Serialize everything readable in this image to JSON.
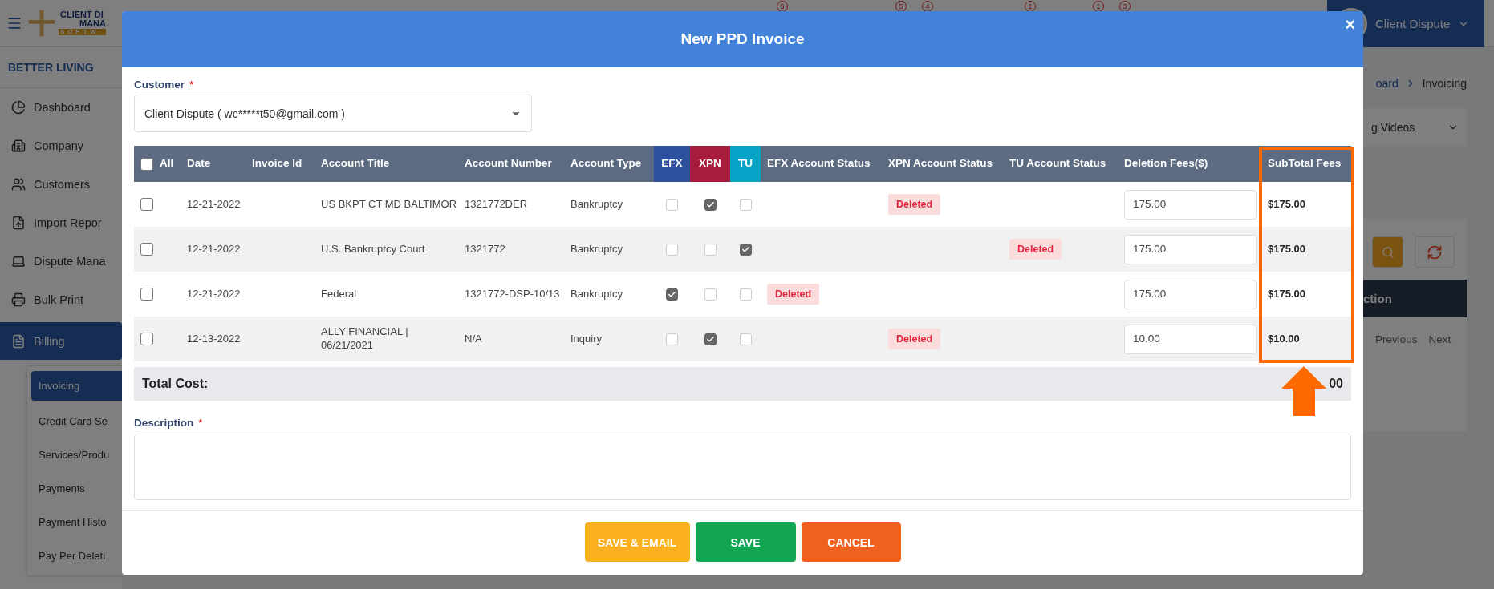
{
  "app": {
    "logo": [
      "CLIENT DI",
      "MANA",
      "SOFTW"
    ],
    "company": "BETTER LIVING",
    "badges": [
      "5",
      "5",
      "4",
      "1",
      "1",
      "3"
    ],
    "user": "Client Dispute"
  },
  "sidebar": {
    "items": [
      {
        "label": "Dashboard",
        "selected": false
      },
      {
        "label": "Company",
        "selected": false
      },
      {
        "label": "Customers",
        "selected": false
      },
      {
        "label": "Import Repor",
        "selected": false
      },
      {
        "label": "Dispute Mana",
        "selected": false
      },
      {
        "label": "Bulk Print",
        "selected": false
      },
      {
        "label": "Billing",
        "selected": true,
        "expanded": true,
        "children": [
          {
            "label": "Invoicing",
            "selected": true
          },
          {
            "label": "Credit Card Se",
            "selected": false
          },
          {
            "label": "Services/Produ",
            "selected": false
          },
          {
            "label": "Payments",
            "selected": false
          },
          {
            "label": "Payment Histo",
            "selected": false
          },
          {
            "label": "Pay Per Deleti",
            "selected": false
          }
        ]
      }
    ]
  },
  "page": {
    "breadcrumb": [
      "oard",
      "Invoicing"
    ],
    "videos_dropdown": "g Videos",
    "table_header": "ction",
    "pagination": [
      "Previous",
      "Next"
    ]
  },
  "modal": {
    "title": "New PPD Invoice",
    "close": "×",
    "customer": {
      "label": "Customer",
      "required_mark": "*",
      "value": "Client Dispute ( wc*****t50@gmail.com )"
    },
    "columns": [
      {
        "label": "All",
        "kind": "select"
      },
      {
        "label": "Date"
      },
      {
        "label": "Invoice Id"
      },
      {
        "label": "Account Title"
      },
      {
        "label": "Account Number"
      },
      {
        "label": "Account Type"
      },
      {
        "label": "EFX",
        "color": "#2c4f9e"
      },
      {
        "label": "XPN",
        "color": "#a51c3c"
      },
      {
        "label": "TU",
        "color": "#0aa3c8"
      },
      {
        "label": "EFX Account Status"
      },
      {
        "label": "XPN Account Status"
      },
      {
        "label": "TU Account Status"
      },
      {
        "label": "Deletion Fees($)"
      },
      {
        "label": "SubTotal Fees"
      }
    ],
    "select_all": {
      "checked": false
    },
    "rows": [
      {
        "checked": false,
        "date": "12-21-2022",
        "title": "US BKPT CT MD BALTIMOR",
        "number": "1321772DER",
        "type": "Bankruptcy",
        "efx": false,
        "xpn": true,
        "tu": false,
        "efx_status": "",
        "xpn_status": "Deleted",
        "tu_status": "",
        "fee": "175.00",
        "subtotal": "$175.00"
      },
      {
        "checked": false,
        "date": "12-21-2022",
        "title": "U.S. Bankruptcy Court",
        "number": "1321772",
        "type": "Bankruptcy",
        "efx": false,
        "xpn": false,
        "tu": true,
        "efx_status": "",
        "xpn_status": "",
        "tu_status": "Deleted",
        "fee": "175.00",
        "subtotal": "$175.00"
      },
      {
        "checked": false,
        "date": "12-21-2022",
        "title": "Federal",
        "number": "1321772-DSP-10/13",
        "type": "Bankruptcy",
        "efx": true,
        "xpn": false,
        "tu": false,
        "efx_status": "Deleted",
        "xpn_status": "",
        "tu_status": "",
        "fee": "175.00",
        "subtotal": "$175.00"
      },
      {
        "checked": false,
        "date": "12-13-2022",
        "title": "ALLY FINANCIAL | 06/21/2021",
        "number": "N/A",
        "type": "Inquiry",
        "efx": false,
        "xpn": true,
        "tu": false,
        "efx_status": "",
        "xpn_status": "Deleted",
        "tu_status": "",
        "fee": "10.00",
        "subtotal": "$10.00"
      }
    ],
    "total": {
      "label": "Total Cost:",
      "value": "00"
    },
    "description": {
      "label": "Description",
      "required_mark": "*"
    },
    "buttons": [
      {
        "label": "SAVE & EMAIL",
        "kind": "save-email"
      },
      {
        "label": "SAVE",
        "kind": "save"
      },
      {
        "label": "CANCEL",
        "kind": "cancel"
      }
    ]
  }
}
